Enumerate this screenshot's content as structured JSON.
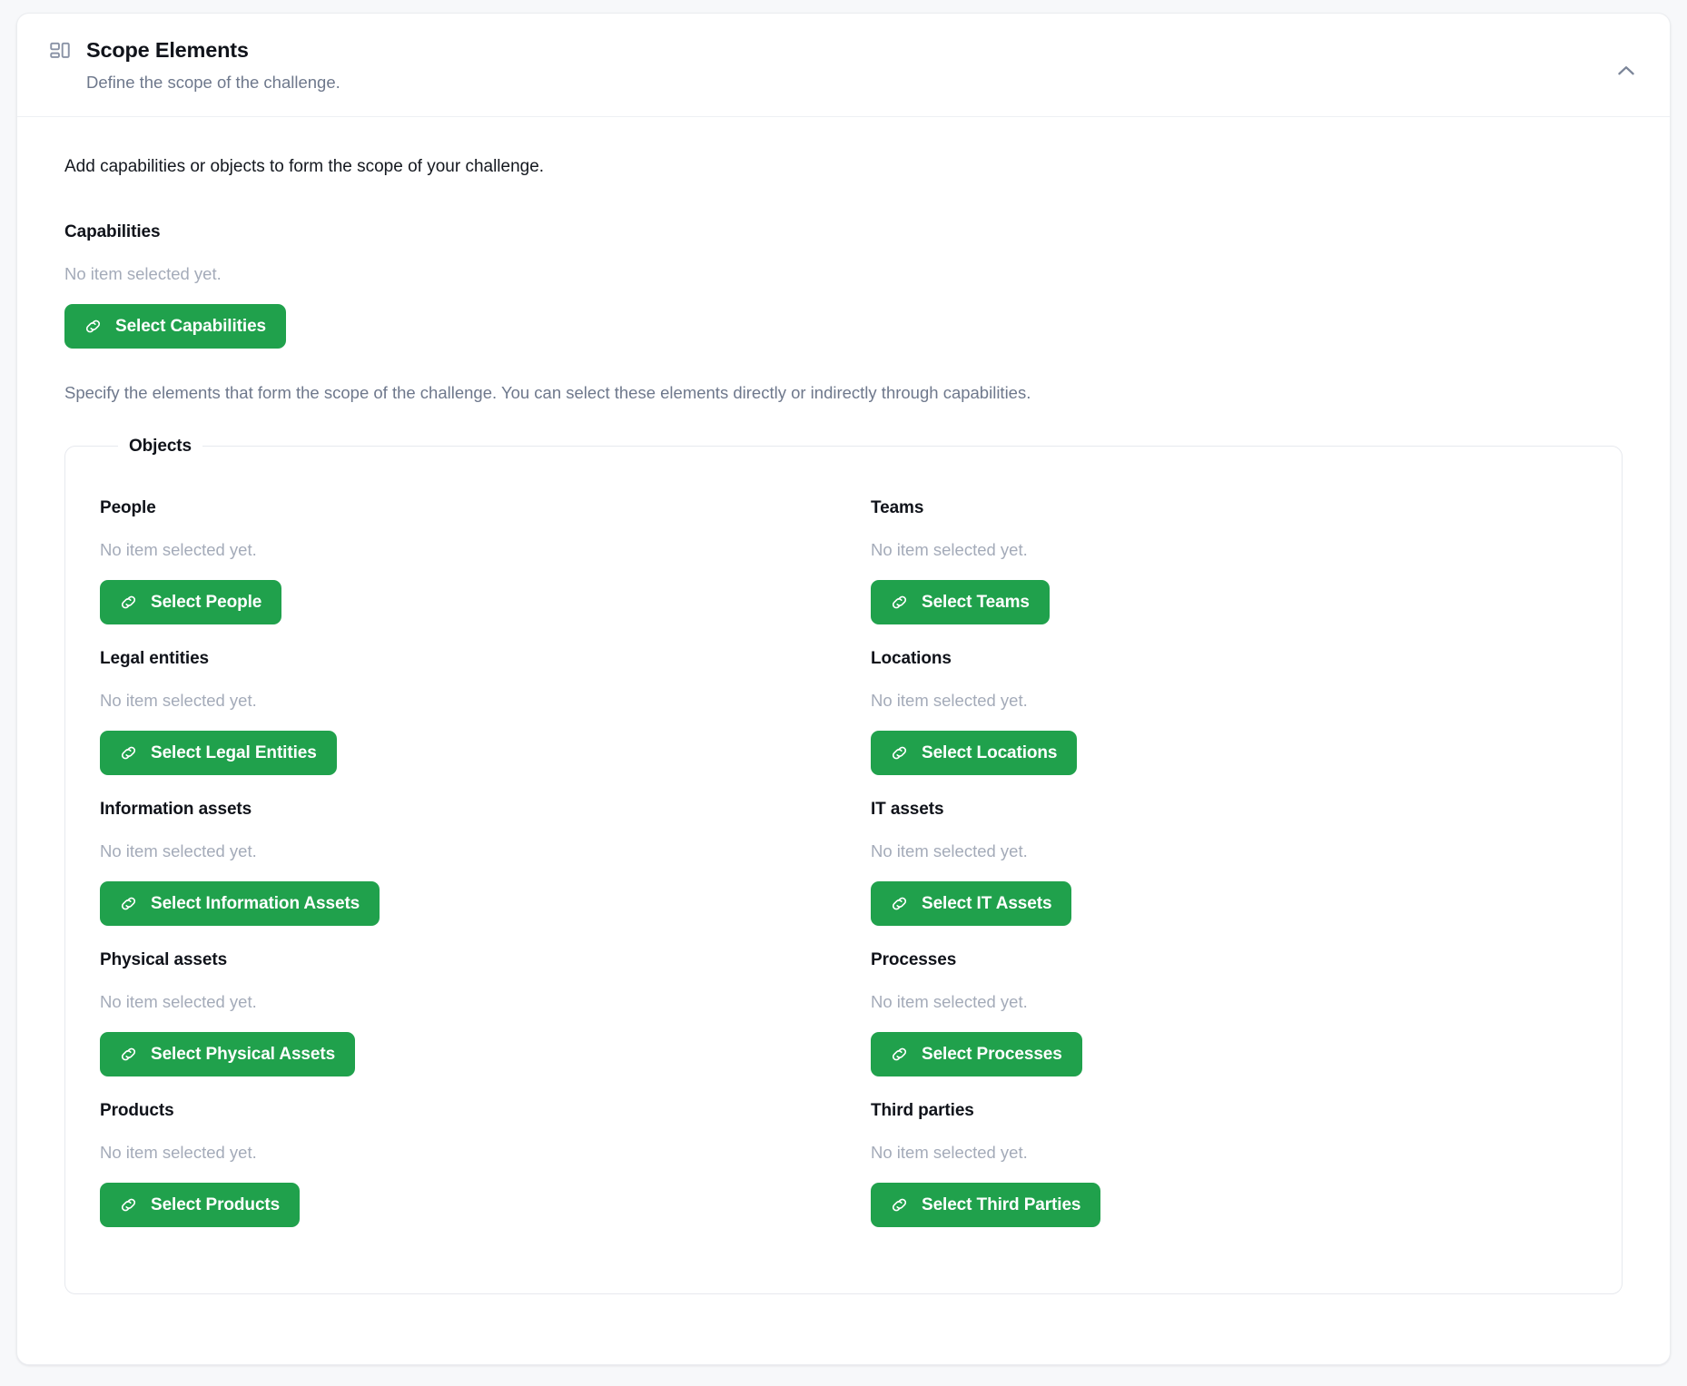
{
  "header": {
    "title": "Scope Elements",
    "subtitle": "Define the scope of the challenge.",
    "icon": "layout-dashboard-icon",
    "collapse_icon": "chevron-up-icon"
  },
  "body": {
    "intro": "Add capabilities or objects to form the scope of your challenge.",
    "capabilities": {
      "label": "Capabilities",
      "empty": "No item selected yet.",
      "button": "Select Capabilities",
      "button_icon": "link-icon"
    },
    "description": "Specify the elements that form the scope of the challenge. You can select these elements directly or indirectly through capabilities.",
    "objects": {
      "legend": "Objects",
      "empty": "No item selected yet.",
      "button_icon": "link-icon",
      "items": [
        {
          "label": "People",
          "empty": "No item selected yet.",
          "button": "Select People"
        },
        {
          "label": "Teams",
          "empty": "No item selected yet.",
          "button": "Select Teams"
        },
        {
          "label": "Legal entities",
          "empty": "No item selected yet.",
          "button": "Select Legal Entities"
        },
        {
          "label": "Locations",
          "empty": "No item selected yet.",
          "button": "Select Locations"
        },
        {
          "label": "Information assets",
          "empty": "No item selected yet.",
          "button": "Select Information Assets"
        },
        {
          "label": "IT assets",
          "empty": "No item selected yet.",
          "button": "Select IT Assets"
        },
        {
          "label": "Physical assets",
          "empty": "No item selected yet.",
          "button": "Select Physical Assets"
        },
        {
          "label": "Processes",
          "empty": "No item selected yet.",
          "button": "Select Processes"
        },
        {
          "label": "Products",
          "empty": "No item selected yet.",
          "button": "Select Products"
        },
        {
          "label": "Third parties",
          "empty": "No item selected yet.",
          "button": "Select Third Parties"
        }
      ]
    }
  },
  "colors": {
    "accent_green": "#20a14c",
    "page_background": "#f7f8fa",
    "card_background": "#ffffff",
    "muted_text": "#6e788c",
    "placeholder_text": "#a4abb9"
  }
}
